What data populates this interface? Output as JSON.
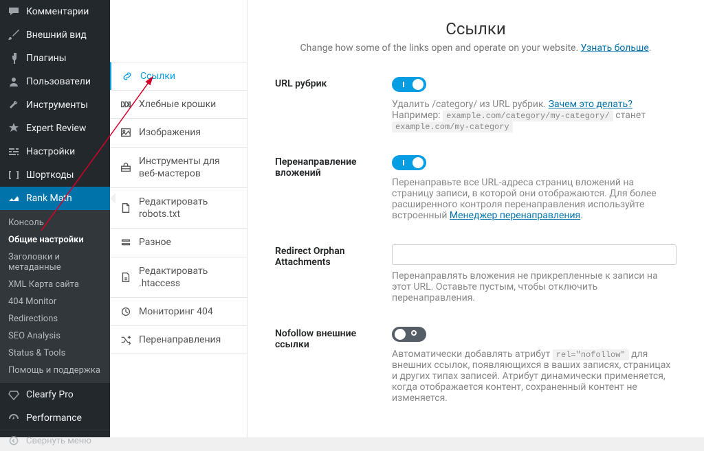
{
  "wp_menu": {
    "truncated": "",
    "comments": "Комментарии",
    "appearance": "Внешний вид",
    "plugins": "Плагины",
    "users": "Пользователи",
    "tools": "Инструменты",
    "expert": "Expert Review",
    "settings": "Настройки",
    "shortcodes": "Шорткоды",
    "rankmath": "Rank Math",
    "sub": {
      "console": "Консоль",
      "general": "Общие настройки",
      "titles": "Заголовки и метаданные",
      "xml": "XML Карта сайта",
      "fof": "404 Monitor",
      "redir": "Redirections",
      "seo": "SEO Analysis",
      "status": "Status & Tools",
      "help": "Помощь и поддержка"
    },
    "clearfy": "Clearfy Pro",
    "performance": "Performance",
    "collapse": "Свернуть меню"
  },
  "tabs": {
    "links": "Ссылки",
    "bread": "Хлебные крошки",
    "images": "Изображения",
    "webmaster": "Инструменты для веб-мастеров",
    "robots": "Редактировать robots.txt",
    "misc": "Разное",
    "htaccess": "Редактировать .htaccess",
    "monitor": "Мониторинг 404",
    "redirs": "Перенаправления"
  },
  "page": {
    "title": "Ссылки",
    "desc": "Change how some of the links open and operate on your website. ",
    "learn": "Узнать больше"
  },
  "fields": {
    "cat": {
      "label": "URL рубрик",
      "pre1": "Удалить /category/ из URL рубрик. ",
      "why": "Зачем это делать?",
      "pre2": "Например: ",
      "code1": "example.com/category/my-category/",
      "will": " станет ",
      "code2": "example.com/my-category"
    },
    "attach": {
      "label": "Перенаправление вложений",
      "desc1": "Перенаправьте все URL-адреса страниц вложений на страницу записи, в которой они отображаются. Для более расширенного контроля перенаправления используйте встроенный ",
      "link": "Менеджер перенаправления",
      "dot": "."
    },
    "orphan": {
      "label": "Redirect Orphan Attachments",
      "desc": "Перенаправлять вложения не прикрепленные к записи на этот URL. Оставьте пустым, чтобы отключить перенаправления."
    },
    "nofollow": {
      "label": "Nofollow внешние ссылки",
      "pre": "Автоматически добавлять атрибут ",
      "code": "rel=\"nofollow\"",
      "post": " для внешних ссылок, появляющихся в ваших записях, страницах и других типах записей. Атрибут динамически применяется, когда отображается контент, сохраненный контент не изменяется."
    }
  }
}
